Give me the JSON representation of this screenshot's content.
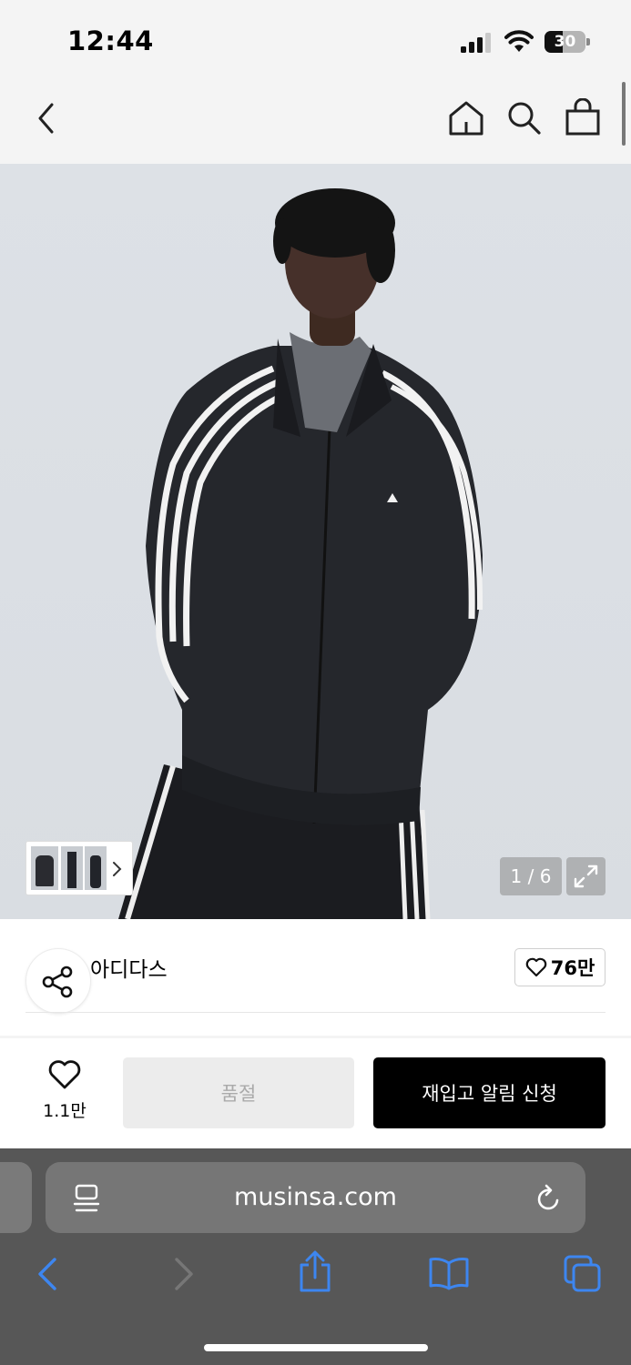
{
  "status_bar": {
    "time": "12:44",
    "battery": "30"
  },
  "header": {
    "back_icon": "chevron-left-icon",
    "home_icon": "home-icon",
    "search_icon": "search-icon",
    "cart_icon": "shopping-bag-icon"
  },
  "gallery": {
    "counter": "1 / 6",
    "current": 1,
    "total": 6,
    "thumbnail_chevron": "chevron-right-icon",
    "expand_icon": "expand-icon"
  },
  "product": {
    "brand": "아디다스",
    "brand_likes": "76만",
    "share_icon": "share-icon"
  },
  "purchase_bar": {
    "wish_count": "1.1만",
    "soldout_label": "품절",
    "restock_label": "재입고 알림 신청"
  },
  "browser": {
    "url": "musinsa.com",
    "page_menu_icon": "page-menu-icon",
    "reload_icon": "reload-icon",
    "toolbar_icons": [
      "back-icon",
      "forward-icon",
      "share-icon",
      "bookmarks-icon",
      "tabs-icon"
    ]
  },
  "colors": {
    "accent_blue": "#3d86f0",
    "restock_button": "#000000",
    "soldout_button": "#ececec"
  }
}
